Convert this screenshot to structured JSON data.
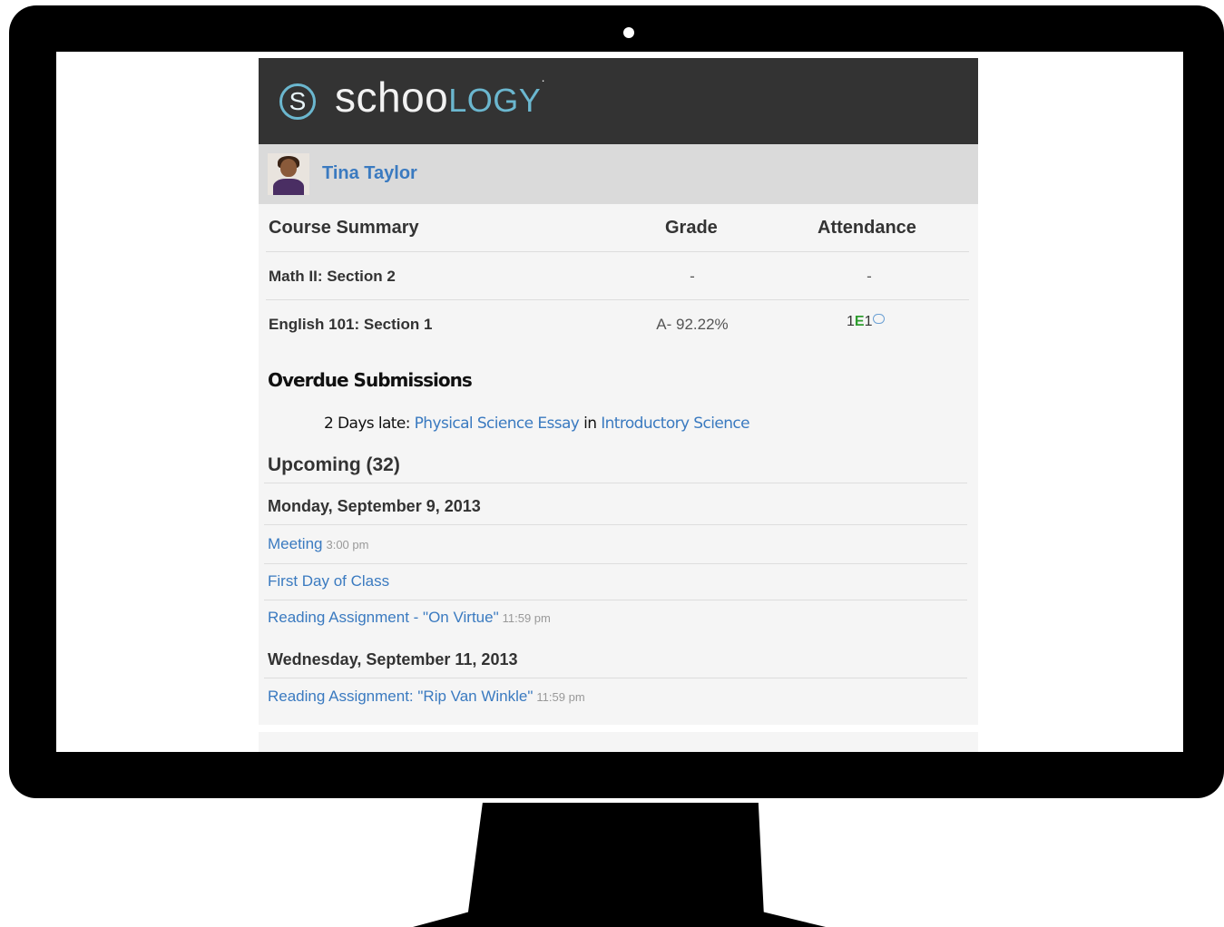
{
  "logo": {
    "mark": "S",
    "text_main": "schoo",
    "text_accent": "LOGY",
    "tm": "·"
  },
  "user": {
    "name": "Tina Taylor"
  },
  "course_table": {
    "headers": [
      "Course Summary",
      "Grade",
      "Attendance"
    ],
    "rows": [
      {
        "course": "Math II: Section 2",
        "grade": "-",
        "attendance": "-"
      },
      {
        "course": "English 101: Section 1",
        "grade": "A- 92.22%",
        "attendance_a": "1",
        "attendance_e": "E",
        "attendance_b": "1"
      }
    ]
  },
  "overdue": {
    "title": "Overdue Submissions",
    "prefix": "2 Days late:",
    "assignment": "Physical Science Essay",
    "in_word": "in",
    "course": "Introductory Science"
  },
  "upcoming": {
    "title": "Upcoming (32)",
    "days": [
      {
        "date": "Monday, September 9, 2013",
        "events": [
          {
            "title": "Meeting",
            "time": "3:00 pm"
          },
          {
            "title": "First Day of Class",
            "time": ""
          },
          {
            "title": "Reading Assignment - \"On Virtue\"",
            "time": "11:59 pm"
          }
        ]
      },
      {
        "date": "Wednesday, September 11, 2013",
        "events": [
          {
            "title": "Reading Assignment: \"Rip Van Winkle\"",
            "time": "11:59 pm"
          }
        ]
      }
    ]
  },
  "colors": {
    "brand_bar": "#333333",
    "link_blue": "#3a7ac0",
    "logo_accent": "#6bb7cf",
    "excused_green": "#2e9c2e"
  }
}
